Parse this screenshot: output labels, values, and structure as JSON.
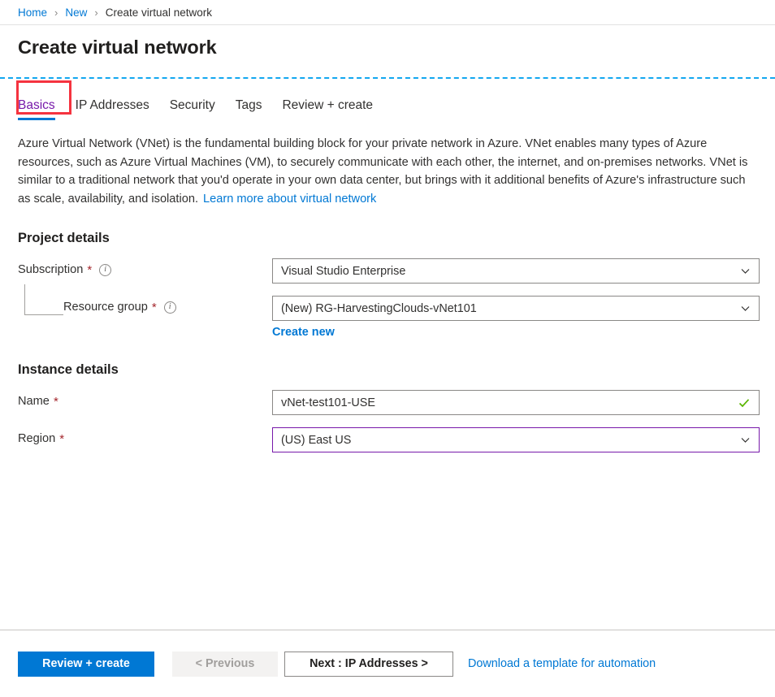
{
  "breadcrumb": {
    "items": [
      {
        "label": "Home",
        "link": true
      },
      {
        "label": "New",
        "link": true
      },
      {
        "label": "Create virtual network",
        "link": false
      }
    ],
    "separator": "›"
  },
  "header": {
    "title": "Create virtual network"
  },
  "tabs": [
    {
      "label": "Basics",
      "active": true,
      "annotated": true
    },
    {
      "label": "IP Addresses",
      "active": false
    },
    {
      "label": "Security",
      "active": false
    },
    {
      "label": "Tags",
      "active": false
    },
    {
      "label": "Review + create",
      "active": false
    }
  ],
  "description": {
    "text": "Azure Virtual Network (VNet) is the fundamental building block for your private network in Azure. VNet enables many types of Azure resources, such as Azure Virtual Machines (VM), to securely communicate with each other, the internet, and on-premises networks. VNet is similar to a traditional network that you'd operate in your own data center, but brings with it additional benefits of Azure's infrastructure such as scale, availability, and isolation.",
    "link_label": "Learn more about virtual network"
  },
  "project_details": {
    "heading": "Project details",
    "subscription": {
      "label": "Subscription",
      "required": "*",
      "info": "i",
      "value": "Visual Studio Enterprise"
    },
    "resource_group": {
      "label": "Resource group",
      "required": "*",
      "info": "i",
      "value": "(New) RG-HarvestingClouds-vNet101",
      "create_new_label": "Create new"
    }
  },
  "instance_details": {
    "heading": "Instance details",
    "name": {
      "label": "Name",
      "required": "*",
      "value": "vNet-test101-USE",
      "validated": true
    },
    "region": {
      "label": "Region",
      "required": "*",
      "value": "(US) East US",
      "focused": true
    }
  },
  "footer": {
    "review_create_label": "Review + create",
    "previous_label": "< Previous",
    "next_label": "Next : IP Addresses >",
    "download_template_label": "Download a template for automation"
  },
  "colors": {
    "accent_blue": "#0078d4",
    "active_tab_purple": "#7719aa",
    "annotation_red": "#f5333f",
    "dashed_separator": "#13a7f0",
    "required_star": "#a4262c",
    "valid_check_green": "#5ab500"
  }
}
